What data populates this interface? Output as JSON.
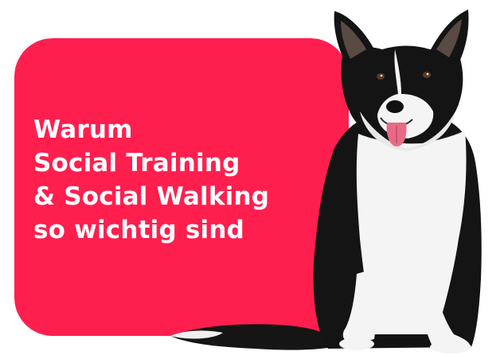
{
  "headline": {
    "line1": "Warum",
    "line2": "Social Training",
    "line3": "& Social Walking",
    "line4": "so wichtig sind"
  },
  "image": {
    "subject": "dog-photo"
  },
  "colors": {
    "banner": "#ff1f4f",
    "text": "#ffffff",
    "fur_black": "#141414",
    "fur_white": "#f4f4f4"
  }
}
